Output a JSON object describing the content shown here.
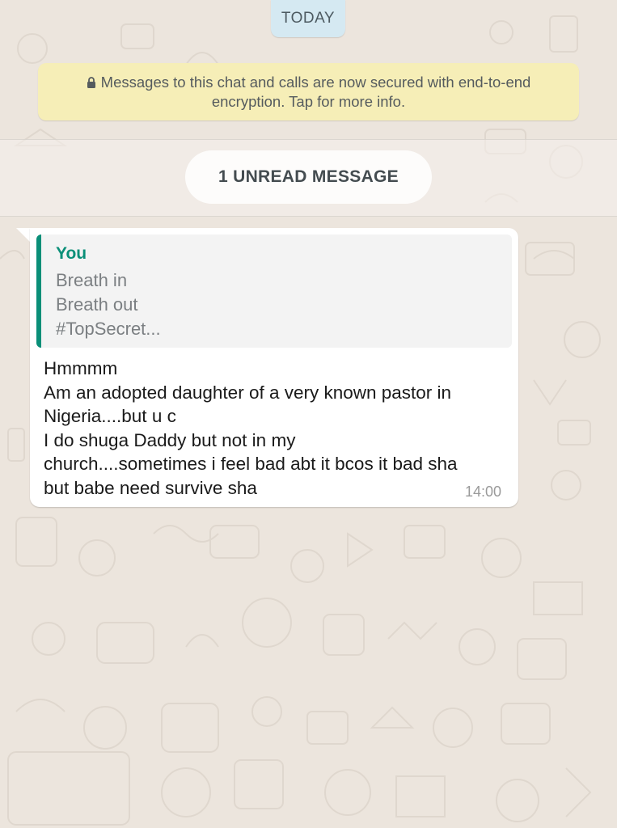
{
  "date_chip": "TODAY",
  "encryption_notice": "Messages to this chat and calls are now secured with end-to-end encryption. Tap for more info.",
  "unread_divider": "1 UNREAD MESSAGE",
  "message": {
    "quoted": {
      "author": "You",
      "lines": [
        "Breath in",
        "Breath out",
        "#TopSecret..."
      ]
    },
    "lines": [
      "Hmmmm",
      "Am an adopted daughter of a very known pastor in",
      "Nigeria....but u c",
      "I do shuga Daddy but not in my",
      "church....sometimes i feel bad abt it bcos it bad sha",
      "but babe need survive sha"
    ],
    "time": "14:00"
  },
  "colors": {
    "chat_background": "#ece5dd",
    "quote_accent": "#0a8f78",
    "encryption_banner": "#f6eeb7",
    "date_chip": "#d5e9f2"
  },
  "icons": [
    "lock-icon"
  ]
}
